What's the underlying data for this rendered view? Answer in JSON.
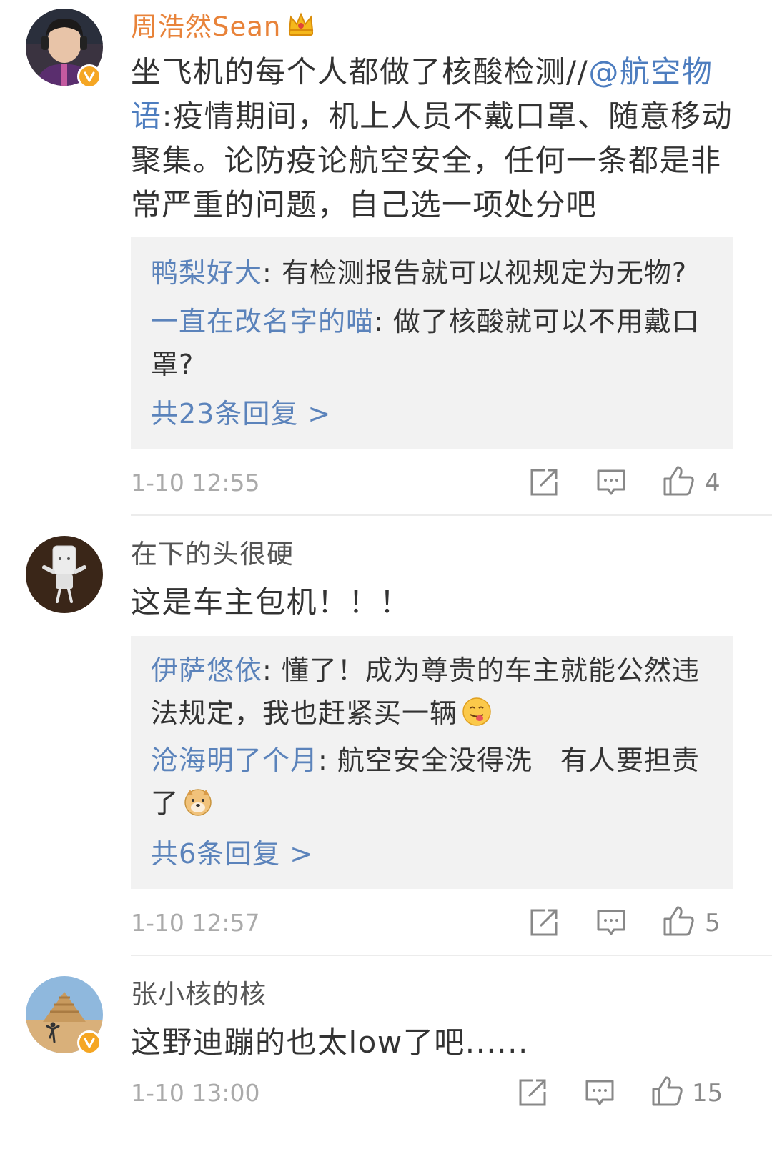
{
  "comments": [
    {
      "username": "周浩然Sean",
      "username_color": "#e8833a",
      "verified": true,
      "body_prefix": "坐飞机的每个人都做了核酸检测//",
      "mention": "@航空物语",
      "body_suffix": ":疫情期间，机上人员不戴口罩、随意移动聚集。论防疫论航空安全，任何一条都是非常严重的问题，自己选一项处分吧",
      "replies": [
        {
          "user": "鸭梨好大",
          "text": ": 有检测报告就可以视规定为无物?"
        },
        {
          "user": "一直在改名字的喵",
          "text": ": 做了核酸就可以不用戴口罩?"
        }
      ],
      "more_replies": "共23条回复 >",
      "time": "1-10 12:55",
      "like_count": "4"
    },
    {
      "username": "在下的头很硬",
      "username_color": "#555555",
      "verified": false,
      "body": "这是车主包机！！！",
      "replies": [
        {
          "user": "伊萨悠依",
          "text": ": 懂了！成为尊贵的车主就能公然违法规定，我也赶紧买一辆",
          "emoji": "tongue-emoji"
        },
        {
          "user": "沧海明了个月",
          "text": ": 航空安全没得洗　有人要担责了",
          "emoji": "doge-emoji"
        }
      ],
      "more_replies": "共6条回复 >",
      "time": "1-10 12:57",
      "like_count": "5"
    },
    {
      "username": "张小核的核",
      "username_color": "#555555",
      "verified": true,
      "body": "这野迪蹦的也太low了吧......",
      "time": "1-10 13:00",
      "like_count": "15"
    }
  ],
  "colors": {
    "link": "#5b83bb",
    "reply_bg": "#f2f2f2",
    "meta": "#aaaaaa",
    "verified_badge": "#f5a623"
  },
  "icons": [
    "share-icon",
    "comment-icon",
    "like-icon",
    "crown-icon",
    "verified-badge-icon"
  ]
}
